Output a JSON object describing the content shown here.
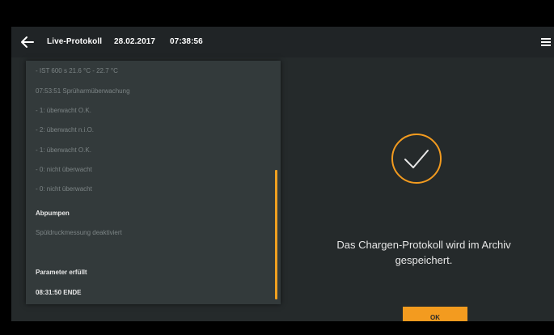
{
  "header": {
    "title": "Live-Protokoll",
    "date": "28.02.2017",
    "time": "07:38:56"
  },
  "log": {
    "lines": [
      "- IST 600 s 21.6 °C - 22.7 °C",
      "07:53:51 Sprüharmüberwachung",
      "- 1: überwacht O.K.",
      "- 2: überwacht n.i.O.",
      "- 1: überwacht O.K.",
      "- 0: nicht überwacht",
      "- 0: nicht überwacht",
      "Abpumpen",
      "Spüldruckmessung deaktiviert",
      "Parameter erfüllt",
      "08:31:50 ENDE"
    ]
  },
  "message": {
    "line1": "Das Chargen-Protokoll wird im Archiv",
    "line2": "gespeichert."
  },
  "ok_button": {
    "label": "OK"
  },
  "icons": {
    "back": "arrow-left-icon",
    "menu": "hamburger-menu-icon",
    "success": "checkmark-circle-icon"
  },
  "colors": {
    "accent": "#f39b1f",
    "background": "#252a2b",
    "panel": "#333a3b"
  }
}
